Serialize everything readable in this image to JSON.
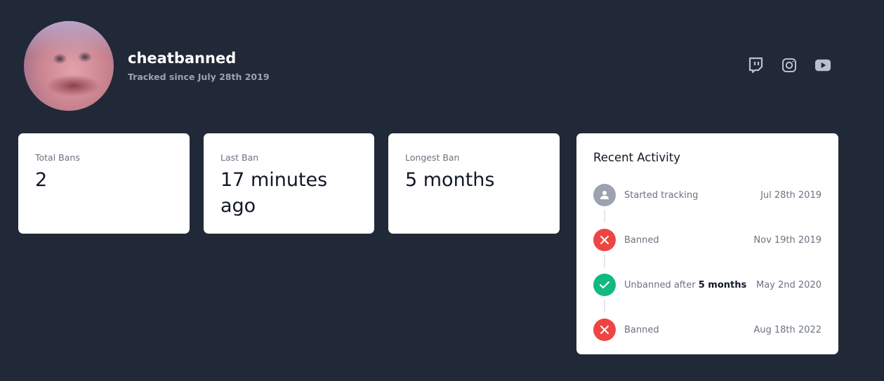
{
  "profile": {
    "username": "cheatbanned",
    "tracked_since": "Tracked since July 28th 2019"
  },
  "socials": [
    {
      "name": "twitch-icon"
    },
    {
      "name": "instagram-icon"
    },
    {
      "name": "youtube-icon"
    }
  ],
  "stats": {
    "total_bans": {
      "label": "Total Bans",
      "value": "2"
    },
    "last_ban": {
      "label": "Last Ban",
      "value": "17 minutes ago"
    },
    "longest_ban": {
      "label": "Longest Ban",
      "value": "5 months"
    }
  },
  "activity": {
    "title": "Recent Activity",
    "items": [
      {
        "text": "Started tracking",
        "date": "Jul 28th 2019",
        "icon": "user-icon",
        "color": "#9ca3af"
      },
      {
        "text": "Banned",
        "date": "Nov 19th 2019",
        "icon": "x-icon",
        "color": "#ef4444"
      },
      {
        "text": "Unbanned after",
        "bold": "5 months",
        "date": "May 2nd 2020",
        "icon": "check-icon",
        "color": "#10b981"
      },
      {
        "text": "Banned",
        "date": "Aug 18th 2022",
        "icon": "x-icon",
        "color": "#ef4444"
      }
    ]
  },
  "colors": {
    "background": "#212837",
    "card": "#ffffff",
    "muted_text": "#9aa3b2"
  }
}
